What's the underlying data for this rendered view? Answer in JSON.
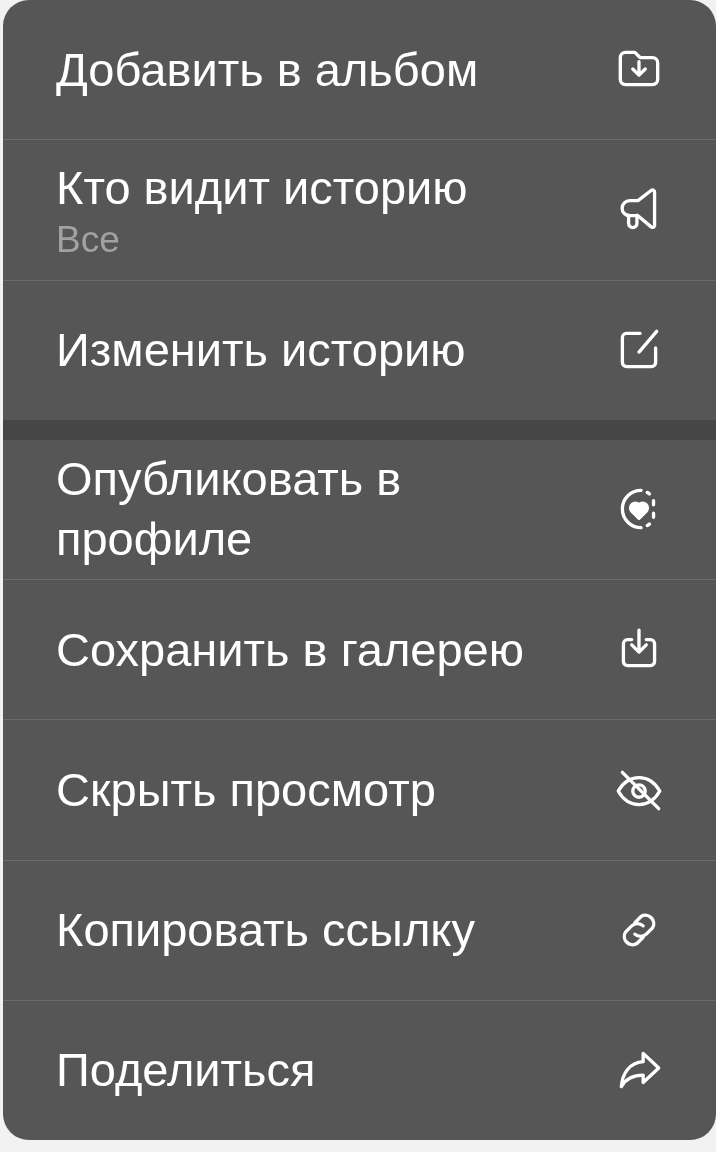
{
  "menu": {
    "groups": [
      {
        "items": [
          {
            "label": "Добавить в альбом"
          },
          {
            "label": "Кто видит историю",
            "subtitle": "Все"
          },
          {
            "label": "Изменить историю"
          }
        ]
      },
      {
        "items": [
          {
            "label": "Опубликовать в профиле"
          },
          {
            "label": "Сохранить в галерею"
          },
          {
            "label": "Скрыть просмотр"
          },
          {
            "label": "Копировать ссылку"
          },
          {
            "label": "Поделиться"
          }
        ]
      }
    ]
  }
}
